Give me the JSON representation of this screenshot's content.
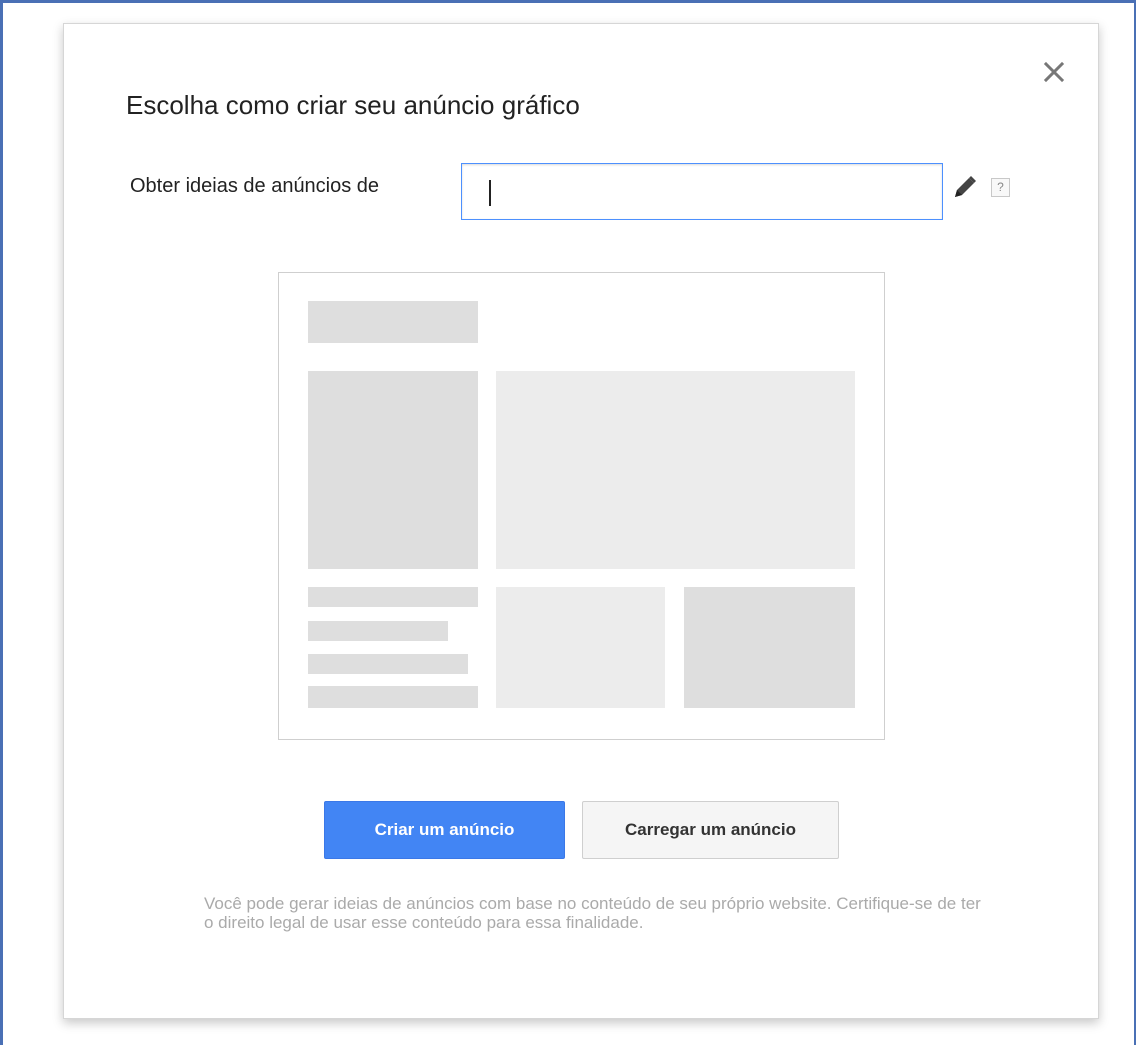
{
  "dialog": {
    "title": "Escolha como criar seu anúncio gráfico",
    "close_icon": "close-icon",
    "url_row": {
      "label": "Obter ideias de anúncios de",
      "input_value": "",
      "edit_icon": "pencil-icon",
      "help_text": "?"
    },
    "preview_icon": "layout-placeholder-icon",
    "buttons": {
      "create_label": "Criar um anúncio",
      "upload_label": "Carregar um anúncio"
    },
    "disclaimer": "Você pode gerar ideias de anúncios com base no conteúdo de seu próprio website. Certifique-se de ter o direito legal de usar esse conteúdo para essa finalidade."
  },
  "colors": {
    "primary": "#4285f4",
    "frame": "#4a70b5",
    "focus": "#4d90fe"
  }
}
